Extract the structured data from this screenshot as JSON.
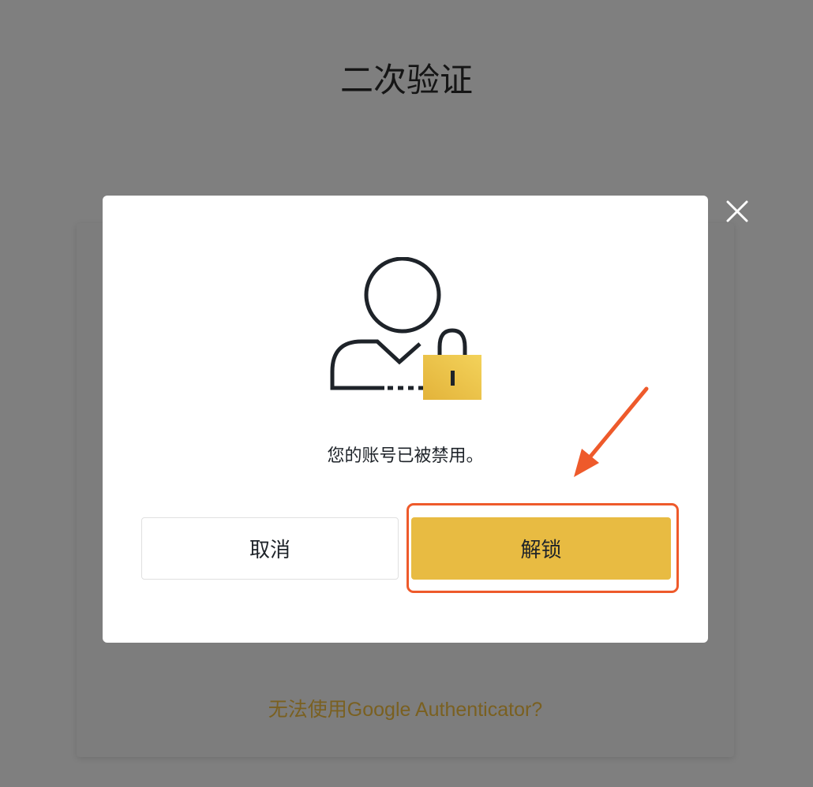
{
  "page": {
    "title": "二次验证",
    "help_link": "无法使用Google Authenticator?"
  },
  "modal": {
    "icon": "user-lock-icon",
    "message": "您的账号已被禁用。",
    "cancel_label": "取消",
    "unlock_label": "解锁",
    "close_icon": "close-icon"
  },
  "colors": {
    "accent": "#e8bb42",
    "annotation": "#ee5a2b",
    "overlay": "#7f7f7f"
  }
}
